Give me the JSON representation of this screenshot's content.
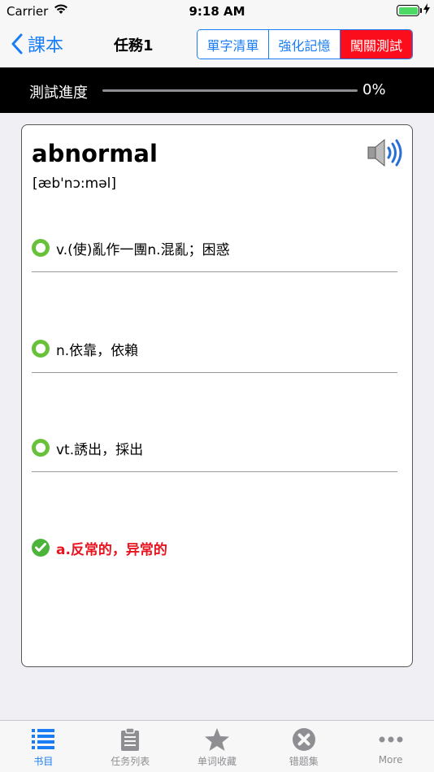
{
  "status_bar": {
    "carrier": "Carrier",
    "time": "9:18 AM"
  },
  "nav": {
    "back_label": "課本",
    "title": "任務1",
    "segments": [
      {
        "label": "單字清單",
        "active": false
      },
      {
        "label": "強化記憶",
        "active": false
      },
      {
        "label": "闖關測試",
        "active": true
      }
    ]
  },
  "progress": {
    "label": "測試進度",
    "value": 0,
    "percent_text": "0%"
  },
  "card": {
    "word": "abnormal",
    "phonetic": "[æb'nɔ:məl]",
    "options": [
      {
        "text": "v.(使)亂作一團n.混亂；困惑",
        "state": "unselected"
      },
      {
        "text": "n.依靠，依賴",
        "state": "unselected"
      },
      {
        "text": "vt.誘出，採出",
        "state": "unselected"
      },
      {
        "text": "a.反常的，异常的",
        "state": "correct"
      }
    ]
  },
  "tabs": [
    {
      "label": "书目",
      "icon": "list-icon",
      "active": true
    },
    {
      "label": "任务列表",
      "icon": "clipboard-icon",
      "active": false
    },
    {
      "label": "单词收藏",
      "icon": "star-icon",
      "active": false
    },
    {
      "label": "错题集",
      "icon": "x-circle-icon",
      "active": false
    },
    {
      "label": "More",
      "icon": "more-icon",
      "active": false
    }
  ],
  "colors": {
    "accent": "#1a7df4",
    "active_segment": "#fc0d1b",
    "correct": "#e8141f",
    "radio": "#67c23a"
  }
}
